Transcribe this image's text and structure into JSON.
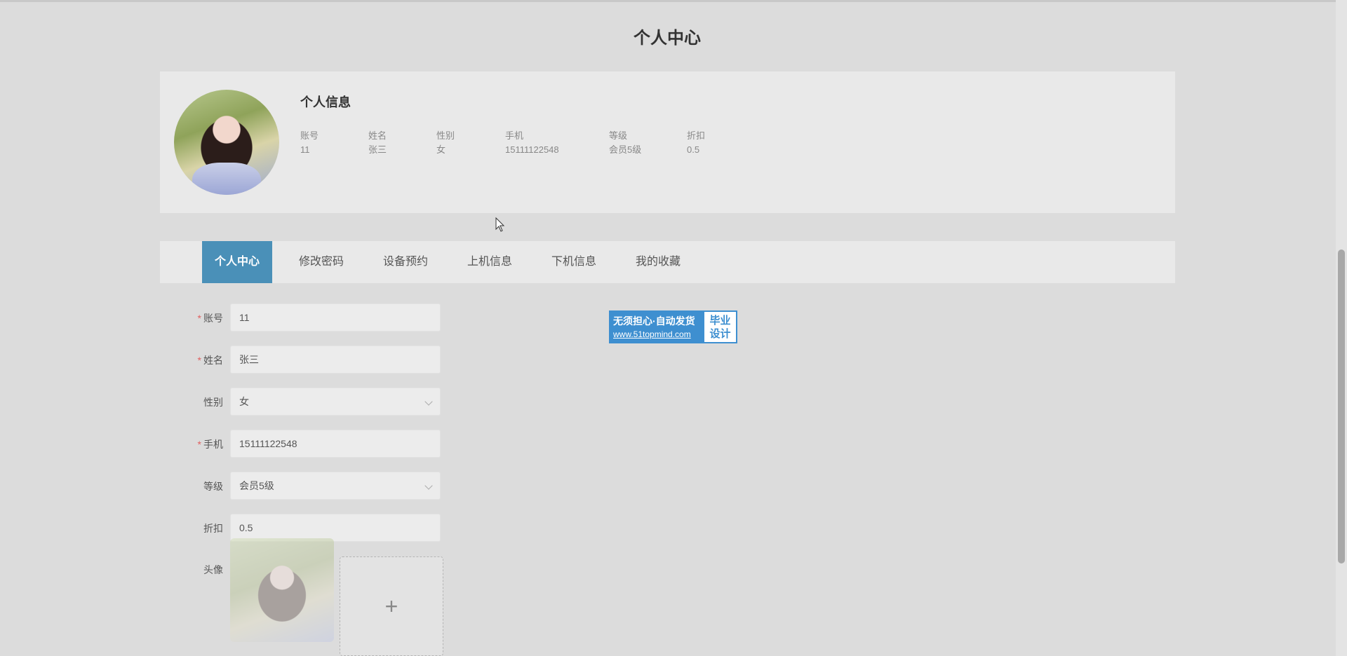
{
  "page_title": "个人中心",
  "profile": {
    "section_title": "个人信息",
    "fields": [
      {
        "label": "账号",
        "value": "11"
      },
      {
        "label": "姓名",
        "value": "张三"
      },
      {
        "label": "性别",
        "value": "女"
      },
      {
        "label": "手机",
        "value": "15111122548"
      },
      {
        "label": "等级",
        "value": "会员5级"
      },
      {
        "label": "折扣",
        "value": "0.5"
      }
    ]
  },
  "tabs": [
    {
      "label": "个人中心",
      "active": true
    },
    {
      "label": "修改密码",
      "active": false
    },
    {
      "label": "设备预约",
      "active": false
    },
    {
      "label": "上机信息",
      "active": false
    },
    {
      "label": "下机信息",
      "active": false
    },
    {
      "label": "我的收藏",
      "active": false
    }
  ],
  "form": {
    "account": {
      "label": "账号",
      "required": "*",
      "value": "11"
    },
    "name": {
      "label": "姓名",
      "required": "*",
      "value": "张三"
    },
    "gender": {
      "label": "性别",
      "value": "女"
    },
    "phone": {
      "label": "手机",
      "required": "*",
      "value": "15111122548"
    },
    "level": {
      "label": "等级",
      "value": "会员5级"
    },
    "discount": {
      "label": "折扣",
      "value": "0.5"
    },
    "avatar": {
      "label": "头像",
      "upload_icon": "+"
    }
  },
  "ad": {
    "line1": "无须担心·自动发货",
    "line2": "www.51topmind.com",
    "right_line1": "毕业",
    "right_line2": "设计"
  },
  "colors": {
    "accent": "#4a90b8",
    "required": "#e06060",
    "ad_blue": "#3e8fd0"
  },
  "icons": {
    "select_arrow": "chevron-down-icon",
    "upload": "plus-icon",
    "cursor": "mouse-pointer-icon"
  }
}
